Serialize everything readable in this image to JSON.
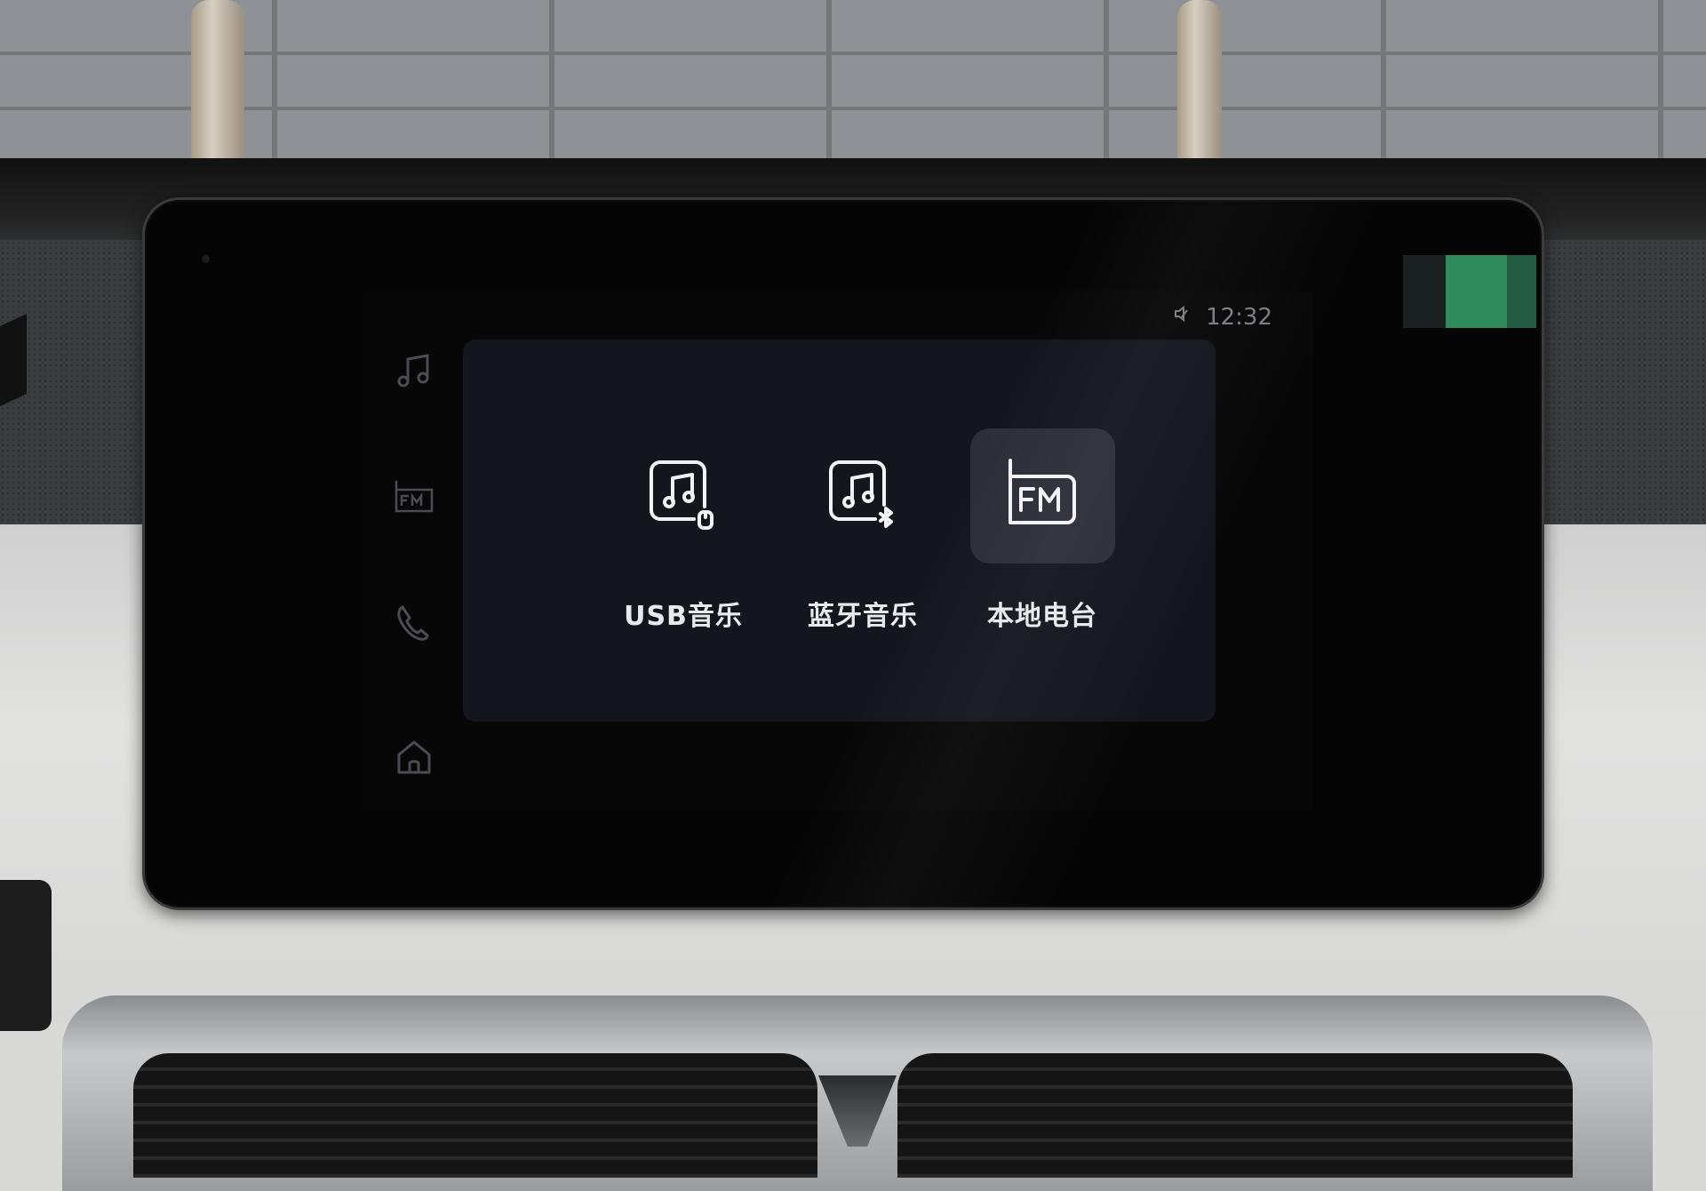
{
  "status_bar": {
    "time": "12:32",
    "status_icon": "mute-icon"
  },
  "nav_rail": {
    "items": [
      {
        "icon": "music-note-icon"
      },
      {
        "icon": "fm-radio-icon"
      },
      {
        "icon": "phone-icon"
      },
      {
        "icon": "home-icon"
      }
    ]
  },
  "sources": [
    {
      "label": "USB音乐",
      "icon": "usb-music-icon",
      "selected": false
    },
    {
      "label": "蓝牙音乐",
      "icon": "bluetooth-music-icon",
      "selected": false
    },
    {
      "label": "本地电台",
      "icon": "fm-radio-icon",
      "selected": true
    }
  ],
  "colors": {
    "panel_bg": "#14161e",
    "selected_tile": "#2c2f38",
    "label_text": "#e9eaee",
    "dim_icon": "#4a4c52",
    "sensor_green": "#2f8a5c"
  }
}
